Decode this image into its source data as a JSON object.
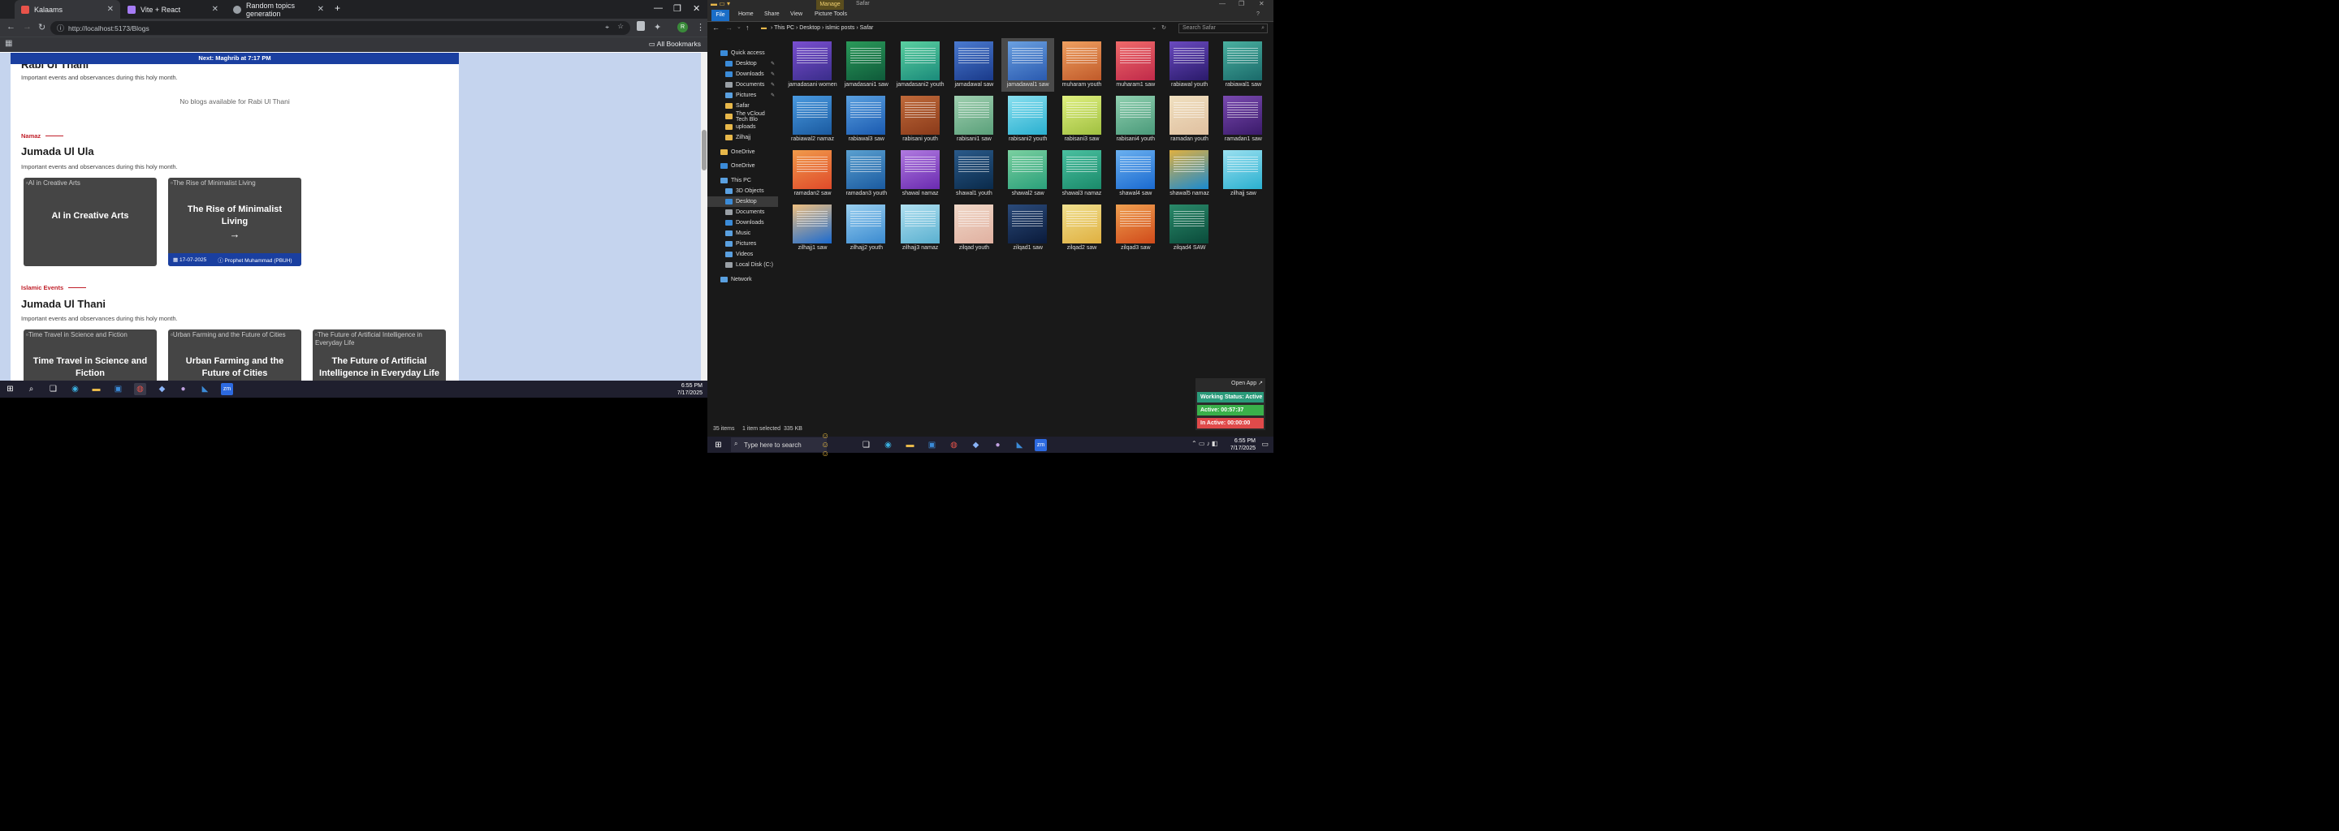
{
  "chrome": {
    "tabs": [
      {
        "label": "Kalaams",
        "active": true,
        "icon_color": "#e8534a"
      },
      {
        "label": "Vite + React",
        "active": false,
        "icon_color": "#a67cf5"
      },
      {
        "label": "Random topics generation",
        "active": false,
        "icon_color": "#9aa0a6"
      }
    ],
    "url": "http://localhost:5173/Blogs",
    "bookmarks_label": "All Bookmarks",
    "profile_initial": "R"
  },
  "page": {
    "prayer_bar": "Next: Maghrib at 7:17 PM",
    "sections": [
      {
        "title": "Rabi Ul Thani",
        "subtitle": "Important events and observances during this holy month.",
        "empty": "No blogs available for Rabi Ul Thani"
      },
      {
        "category": "Namaz",
        "title": "Jumada Ul Ula",
        "subtitle": "Important events and observances during this holy month.",
        "cards": [
          {
            "alt": "AI in Creative Arts",
            "title": "AI in Creative Arts"
          },
          {
            "alt": "The Rise of Minimalist Living",
            "title": "The Rise of Minimalist Living",
            "arrow": "→",
            "date": "17-07-2025",
            "author": "Prophet Muhammad (PBUH)"
          }
        ]
      },
      {
        "category": "Islamic Events",
        "title": "Jumada Ul Thani",
        "subtitle": "Important events and observances during this holy month.",
        "cards": [
          {
            "alt": "Time Travel in Science and Fiction",
            "title": "Time Travel in Science and Fiction"
          },
          {
            "alt": "Urban Farming and the Future of Cities",
            "title": "Urban Farming and the Future of Cities"
          },
          {
            "alt": "The Future of Artificial Intelligence in Everyday Life",
            "title": "The Future of Artificial Intelligence in Everyday Life"
          }
        ]
      }
    ]
  },
  "left_taskbar": {
    "time": "6:55 PM",
    "date": "7/17/2025"
  },
  "explorer": {
    "manage_label": "Manage",
    "window_title": "Safar",
    "ribbon_tabs": [
      "File",
      "Home",
      "Share",
      "View",
      "Picture Tools"
    ],
    "breadcrumb": [
      "This PC",
      "Desktop",
      "islmic posts",
      "Safar"
    ],
    "search_placeholder": "Search Safar",
    "nav": [
      {
        "label": "Quick access",
        "icon_color": "#3b8bd8"
      },
      {
        "label": "Desktop",
        "icon_color": "#3b8bd8",
        "pin": true
      },
      {
        "label": "Downloads",
        "icon_color": "#3b8bd8",
        "pin": true
      },
      {
        "label": "Documents",
        "icon_color": "#9aa0a6",
        "pin": true
      },
      {
        "label": "Pictures",
        "icon_color": "#5aa0e0",
        "pin": true
      },
      {
        "label": "Safar",
        "icon_color": "#e8b84a"
      },
      {
        "label": "The vCloud Tech Blo",
        "icon_color": "#e8b84a"
      },
      {
        "label": "uploads",
        "icon_color": "#e8b84a"
      },
      {
        "label": "Zilhajj",
        "icon_color": "#e8b84a"
      },
      {
        "label": "OneDrive",
        "icon_color": "#e8b84a"
      },
      {
        "label": "OneDrive",
        "icon_color": "#3b8bd8"
      },
      {
        "label": "This PC",
        "icon_color": "#5aa0e0"
      },
      {
        "label": "3D Objects",
        "icon_color": "#5aa0e0"
      },
      {
        "label": "Desktop",
        "icon_color": "#3b8bd8",
        "selected": true
      },
      {
        "label": "Documents",
        "icon_color": "#9aa0a6"
      },
      {
        "label": "Downloads",
        "icon_color": "#3b8bd8"
      },
      {
        "label": "Music",
        "icon_color": "#5aa0e0"
      },
      {
        "label": "Pictures",
        "icon_color": "#5aa0e0"
      },
      {
        "label": "Videos",
        "icon_color": "#5aa0e0"
      },
      {
        "label": "Local Disk (C:)",
        "icon_color": "#9aa0a6"
      },
      {
        "label": "Network",
        "icon_color": "#5aa0e0"
      }
    ],
    "files": [
      {
        "name": "jamadasani women",
        "c1": "#3a2d8a",
        "c2": "#7a4fd0"
      },
      {
        "name": "jamadasani1 saw",
        "c1": "#0f5a3a",
        "c2": "#2a9a5a"
      },
      {
        "name": "jamadasani2 youth",
        "c1": "#1a8a7a",
        "c2": "#5ad0a0"
      },
      {
        "name": "jamadawal saw",
        "c1": "#1a3a8a",
        "c2": "#4a7ad0"
      },
      {
        "name": "jamadawal1 saw",
        "c1": "#2a5ab0",
        "c2": "#6aa0e0",
        "selected": true
      },
      {
        "name": "muharam youth",
        "c1": "#c05a2a",
        "c2": "#f0a060"
      },
      {
        "name": "muharam1 saw",
        "c1": "#c02a4a",
        "c2": "#f06a6a"
      },
      {
        "name": "rabiawal youth",
        "c1": "#2a1a6a",
        "c2": "#6a4ac0"
      },
      {
        "name": "rabiawal1 saw",
        "c1": "#1a6a6a",
        "c2": "#4ab0a0"
      },
      {
        "name": "rabiawal2 namaz",
        "c1": "#1a5aa0",
        "c2": "#4a9ae0"
      },
      {
        "name": "rabiawal3 saw",
        "c1": "#1a5ab0",
        "c2": "#5aa0e0"
      },
      {
        "name": "rabisani youth",
        "c1": "#8a3a1a",
        "c2": "#c06a3a"
      },
      {
        "name": "rabisani1 saw",
        "c1": "#5aa07a",
        "c2": "#a0d0b0"
      },
      {
        "name": "rabisani2 youth",
        "c1": "#2ab0d0",
        "c2": "#8ae0f0"
      },
      {
        "name": "rabisani3 saw",
        "c1": "#a0c040",
        "c2": "#e0f080"
      },
      {
        "name": "rabisani4 youth",
        "c1": "#4a9a7a",
        "c2": "#90d0b0"
      },
      {
        "name": "ramadan youth",
        "c1": "#e0c0a0",
        "c2": "#f0e0c0"
      },
      {
        "name": "ramadan1 saw",
        "c1": "#3a1a6a",
        "c2": "#7a4ab0"
      },
      {
        "name": "ramadan2 saw",
        "c1": "#e04a2a",
        "c2": "#f09a4a"
      },
      {
        "name": "ramadan3 youth",
        "c1": "#1a5aa0",
        "c2": "#5aa0d0"
      },
      {
        "name": "shawal namaz",
        "c1": "#6a2ab0",
        "c2": "#b07ae0"
      },
      {
        "name": "shawal1 youth",
        "c1": "#0a2a4a",
        "c2": "#2a5a8a"
      },
      {
        "name": "shawal2 saw",
        "c1": "#2aa07a",
        "c2": "#7ad0a0"
      },
      {
        "name": "shawal3 namaz",
        "c1": "#1a8a6a",
        "c2": "#4ac0a0"
      },
      {
        "name": "shawal4 saw",
        "c1": "#1a6ad0",
        "c2": "#6ab0f0"
      },
      {
        "name": "shawal5 namaz",
        "c1": "#1a8ad0",
        "c2": "#e0b040"
      },
      {
        "name": "zilhajj saw",
        "c1": "#2ab0d0",
        "c2": "#9ae0f0"
      },
      {
        "name": "zilhajj1 saw",
        "c1": "#1a6ad0",
        "c2": "#f0c080"
      },
      {
        "name": "zilhajj2 youth",
        "c1": "#3a8ad0",
        "c2": "#9ad0f0"
      },
      {
        "name": "zilhajj3 namaz",
        "c1": "#5ab0d0",
        "c2": "#b0e0f0"
      },
      {
        "name": "zilqad youth",
        "c1": "#e0b0a0",
        "c2": "#f0d8c8"
      },
      {
        "name": "zilqad1 saw",
        "c1": "#0a1a3a",
        "c2": "#2a4a7a"
      },
      {
        "name": "zilqad2 saw",
        "c1": "#e0b040",
        "c2": "#f0e090"
      },
      {
        "name": "zilqad3 saw",
        "c1": "#d04a1a",
        "c2": "#f0a050"
      },
      {
        "name": "zilqad4 SAW",
        "c1": "#0a4a3a",
        "c2": "#2a8a6a"
      }
    ],
    "status_count": "35 items",
    "status_selected": "1 item selected  335 KB"
  },
  "timer": {
    "open_label": "Open App ↗",
    "working": "Working Status: Active",
    "active": "Active: 00:57:37",
    "inactive": "In Active: 00:00:00"
  },
  "right_taskbar": {
    "search_placeholder": "Type here to search",
    "time": "6:55 PM",
    "date": "7/17/2025"
  }
}
